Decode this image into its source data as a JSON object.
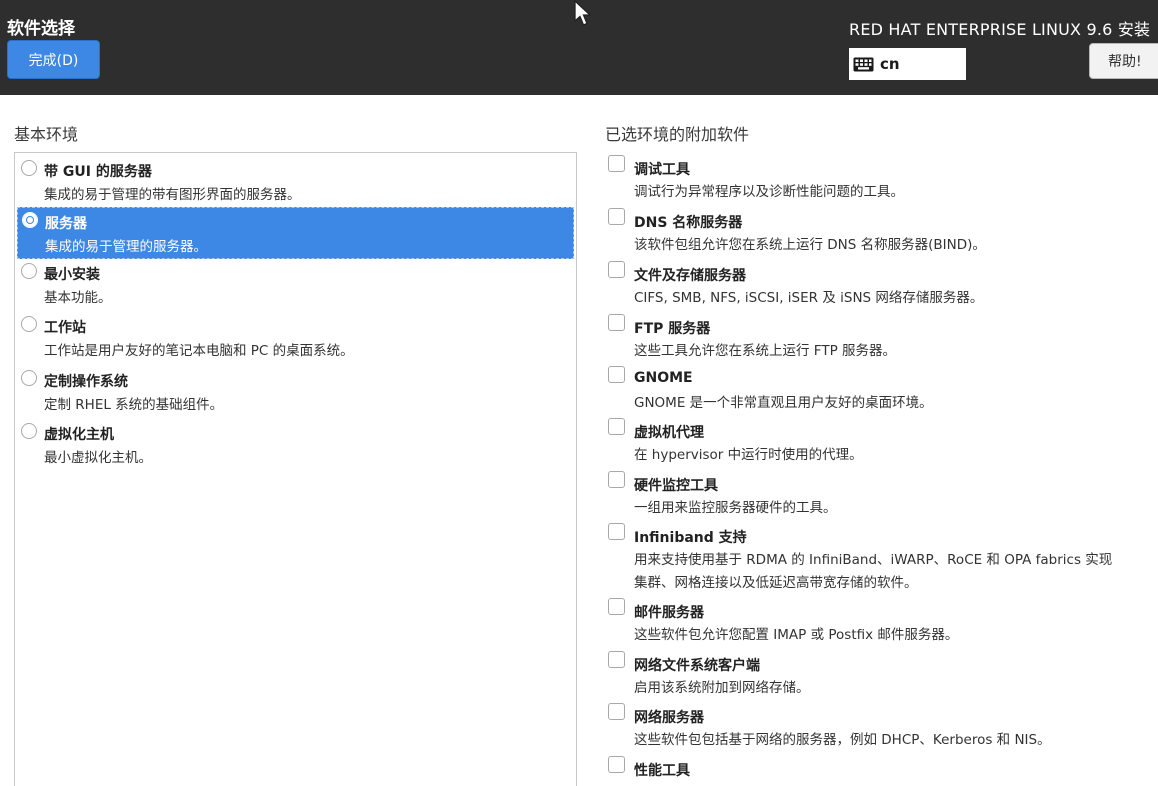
{
  "header": {
    "title": "软件选择",
    "done_label": "完成(D)",
    "product": "RED HAT ENTERPRISE LINUX 9.6 安装",
    "keyboard_layout": "cn",
    "help_label": "帮助!"
  },
  "left": {
    "label": "基本环境",
    "items": [
      {
        "title": "带 GUI 的服务器",
        "desc": "集成的易于管理的带有图形界面的服务器。"
      },
      {
        "title": "服务器",
        "desc": "集成的易于管理的服务器。"
      },
      {
        "title": "最小安装",
        "desc": "基本功能。"
      },
      {
        "title": "工作站",
        "desc": "工作站是用户友好的笔记本电脑和 PC 的桌面系统。"
      },
      {
        "title": "定制操作系统",
        "desc": "定制 RHEL 系统的基础组件。"
      },
      {
        "title": "虚拟化主机",
        "desc": "最小虚拟化主机。"
      }
    ],
    "selected_index": 1
  },
  "right": {
    "label": "已选环境的附加软件",
    "items": [
      {
        "title": "调试工具",
        "desc": "调试行为异常程序以及诊断性能问题的工具。"
      },
      {
        "title": "DNS 名称服务器",
        "desc": "该软件包组允许您在系统上运行 DNS 名称服务器(BIND)。"
      },
      {
        "title": "文件及存储服务器",
        "desc": "CIFS, SMB, NFS, iSCSI, iSER 及 iSNS 网络存储服务器。"
      },
      {
        "title": "FTP 服务器",
        "desc": "这些工具允许您在系统上运行 FTP 服务器。"
      },
      {
        "title": "GNOME",
        "desc": "GNOME 是一个非常直观且用户友好的桌面环境。"
      },
      {
        "title": "虚拟机代理",
        "desc": "在 hypervisor 中运行时使用的代理。"
      },
      {
        "title": "硬件监控工具",
        "desc": "一组用来监控服务器硬件的工具。"
      },
      {
        "title": "Infiniband 支持",
        "desc": "用来支持使用基于 RDMA 的 InfiniBand、iWARP、RoCE 和 OPA fabrics 实现",
        "desc2": "集群、网格连接以及低延迟高带宽存储的软件。"
      },
      {
        "title": "邮件服务器",
        "desc": "这些软件包允许您配置 IMAP 或 Postfix 邮件服务器。"
      },
      {
        "title": "网络文件系统客户端",
        "desc": "启用该系统附加到网络存储。"
      },
      {
        "title": "网络服务器",
        "desc": "这些软件包包括基于网络的服务器，例如 DHCP、Kerberos 和 NIS。"
      },
      {
        "title": "性能工具"
      }
    ]
  }
}
